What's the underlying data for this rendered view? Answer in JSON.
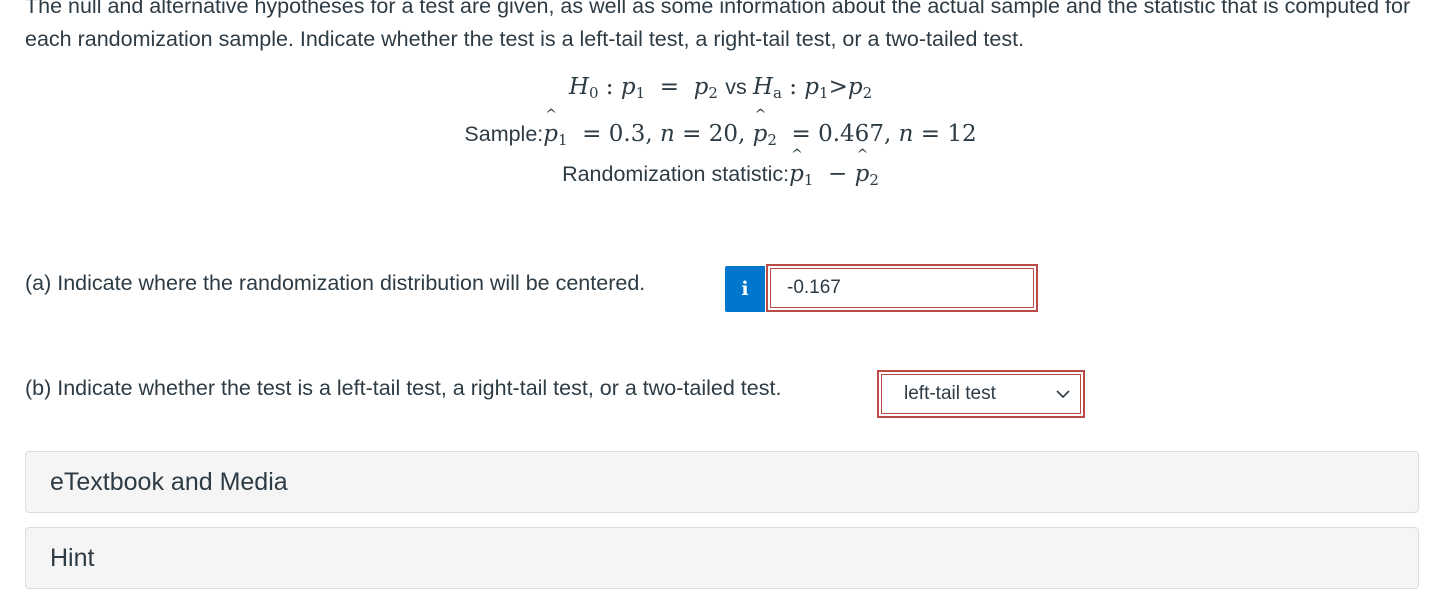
{
  "intro_text": "The null and alternative hypotheses for a test are given, as well as some information about the actual sample and the statistic that is computed for each randomization sample. Indicate whether the test is a left-tail test, a right-tail test, or a two-tailed test.",
  "hypotheses": {
    "H0_symbol": "H",
    "H0_sub": "0",
    "p1": "p",
    "p1_sub": "1",
    "equals": "=",
    "p2": "p",
    "p2_sub": "2",
    "vs": "vs",
    "Ha_symbol": "H",
    "Ha_sub": "a",
    "gt": ">"
  },
  "sample": {
    "label": "Sample:",
    "p1_hat_value": "0.3",
    "n1": "20",
    "p2_hat_value": "0.467",
    "n2": "12"
  },
  "statistic": {
    "label": "Randomization statistic:",
    "minus": "−"
  },
  "part_a": {
    "question": "(a) Indicate where the randomization distribution will be centered.",
    "info_icon_label": "i",
    "answer": "-0.167"
  },
  "part_b": {
    "question": "(b) Indicate whether the test is a left-tail test, a right-tail test, or a two-tailed test.",
    "selected_option": "left-tail test"
  },
  "panels": {
    "etextbook": "eTextbook and Media",
    "hint": "Hint"
  },
  "colors": {
    "text": "#2d3b45",
    "info_button": "#0077cc",
    "error_border": "#b94a48",
    "panel_bg": "#f5f5f5"
  }
}
